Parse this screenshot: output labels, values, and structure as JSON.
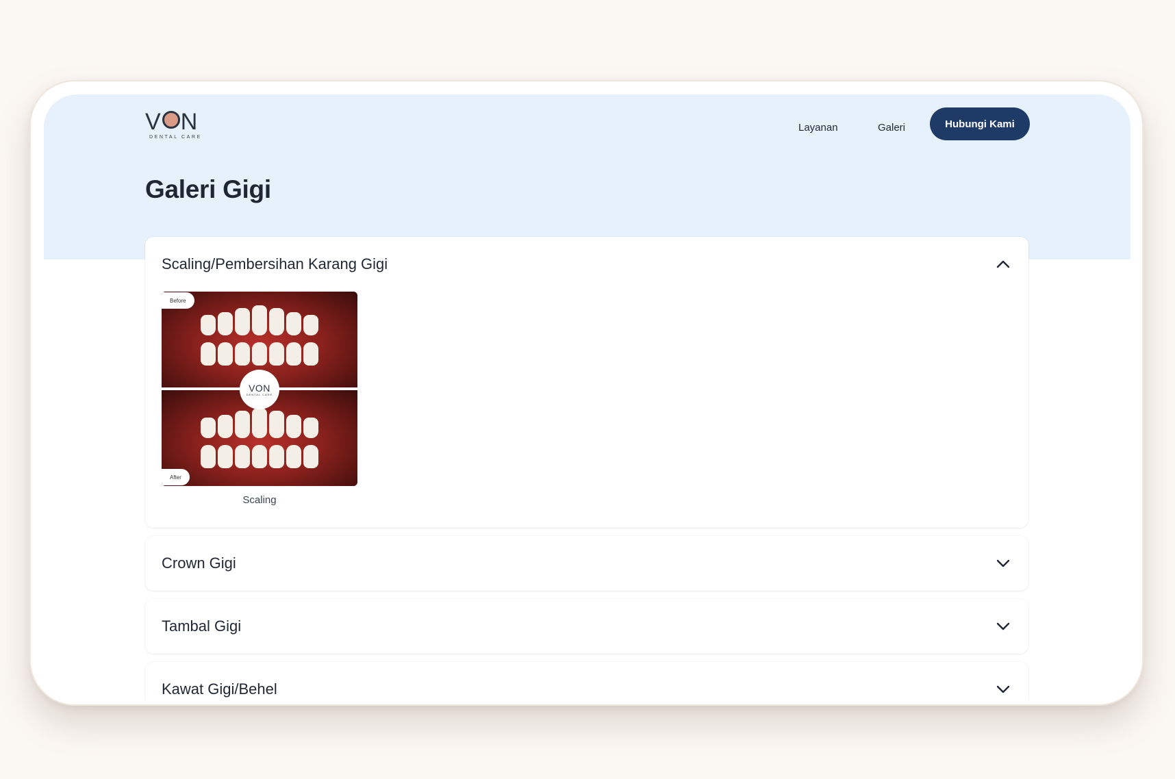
{
  "header": {
    "logo_text": "VON",
    "logo_subtext": "DENTAL CARE",
    "nav": {
      "layanan": "Layanan",
      "galeri": "Galeri",
      "cta": "Hubungi Kami"
    }
  },
  "page_title": "Galeri Gigi",
  "accordion": [
    {
      "title": "Scaling/Pembersihan Karang Gigi",
      "expanded": true,
      "icon": "chevron-up-icon",
      "items": [
        {
          "caption": "Scaling",
          "tag_before": "Before",
          "tag_after": "After",
          "badge_text": "VON",
          "badge_subtext": "DENTAL CARE"
        }
      ]
    },
    {
      "title": "Crown Gigi",
      "expanded": false,
      "icon": "chevron-down-icon"
    },
    {
      "title": "Tambal Gigi",
      "expanded": false,
      "icon": "chevron-down-icon"
    },
    {
      "title": "Kawat Gigi/Behel",
      "expanded": false,
      "icon": "chevron-down-icon"
    }
  ],
  "colors": {
    "page_background": "#fbf7f3",
    "hero_band": "#e6f1fb",
    "cta_background": "#1e3a66",
    "text_primary": "#1f2733"
  }
}
